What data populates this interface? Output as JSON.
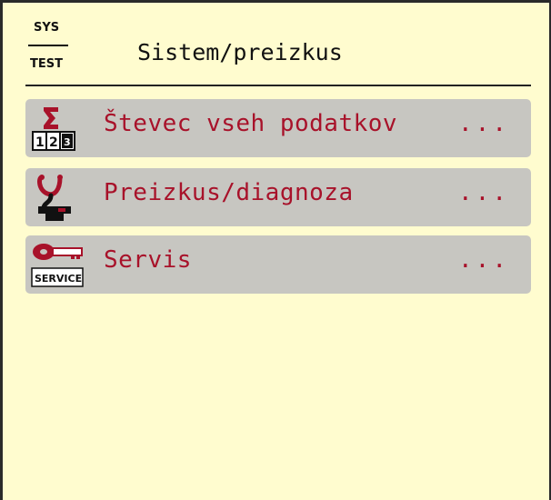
{
  "header": {
    "badge_top": "SYS",
    "badge_bottom": "TEST",
    "title": "Sistem/preizkus"
  },
  "menu": {
    "items": [
      {
        "label": "Števec vseh podatkov",
        "ellipsis": "...",
        "icon": "counter-sigma-icon"
      },
      {
        "label": "Preizkus/diagnoza",
        "ellipsis": "...",
        "icon": "stethoscope-diagnosis-icon"
      },
      {
        "label": "Servis",
        "ellipsis": "...",
        "icon": "service-key-icon",
        "icon_text": "SERVICE"
      }
    ]
  },
  "colors": {
    "background": "#fffccf",
    "item_background": "#c7c6c1",
    "accent_red": "#a8122a",
    "text": "#111111"
  }
}
